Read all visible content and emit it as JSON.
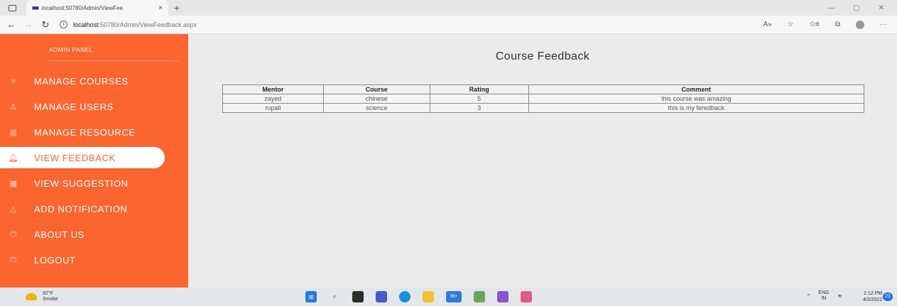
{
  "browser": {
    "tab_title": "localhost:50780/Admin/ViewFee",
    "tab_close": "×",
    "new_tab": "+",
    "url_host": "localhost",
    "url_path": ":50780/Admin/ViewFeedback.aspx"
  },
  "sidebar": {
    "title": "ADMIN PANEL",
    "items": [
      {
        "label": "MANAGE COURSES",
        "icon": "atom-icon"
      },
      {
        "label": "MANAGE USERS",
        "icon": "user-icon"
      },
      {
        "label": "MANAGE RESOURCE",
        "icon": "book-icon"
      },
      {
        "label": "VIEW FEEDBACK",
        "icon": "bell-icon",
        "active": true
      },
      {
        "label": "VIEW SUGGESTION",
        "icon": "calendar-icon"
      },
      {
        "label": "ADD NOTIFICATION",
        "icon": "bell-icon"
      },
      {
        "label": "ABOUT US",
        "icon": "power-icon"
      },
      {
        "label": "LOGOUT",
        "icon": "power-icon"
      }
    ],
    "accent": "#fb6530"
  },
  "main": {
    "title": "Course Feedback",
    "columns": [
      "Mentor",
      "Course",
      "Rating",
      "Comment"
    ],
    "rows": [
      [
        "zayed",
        "chinese",
        "5",
        "this course was amazing"
      ],
      [
        "rupali",
        "science",
        "3",
        "this is my feredback"
      ]
    ]
  },
  "taskbar": {
    "temp": "92°F",
    "weather": "Smoke",
    "lang": "ENG",
    "region": "IN",
    "time": "2:12 PM",
    "date": "4/3/2022",
    "notifications": "21",
    "badge": "99+"
  }
}
